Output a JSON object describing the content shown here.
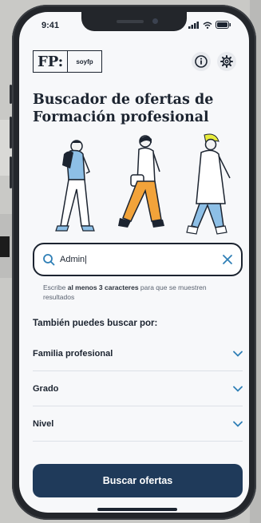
{
  "status_bar": {
    "time": "9:41"
  },
  "logo": {
    "fp": "FP:",
    "soy": "soyfp"
  },
  "header": {
    "info_icon": "info-icon",
    "settings_icon": "gear-icon"
  },
  "page": {
    "title_line1": "Buscador de ofertas de",
    "title_line2": "Formación profesional"
  },
  "search": {
    "value": "Admin|",
    "hint_pre": "Escribe ",
    "hint_bold": "al menos 3 caracteres",
    "hint_post": " para que se muestren resultados"
  },
  "filters": {
    "heading": "También puedes buscar por:",
    "items": [
      {
        "label": "Familia profesional"
      },
      {
        "label": "Grado"
      },
      {
        "label": "Nivel"
      }
    ]
  },
  "cta": {
    "label": "Buscar ofertas"
  },
  "colors": {
    "primary": "#1f3a5a",
    "accent_blue": "#2f7fb6",
    "illustration_blue": "#8dbfe6",
    "illustration_orange": "#f2a33a",
    "illustration_yellow": "#e9ec3c"
  }
}
